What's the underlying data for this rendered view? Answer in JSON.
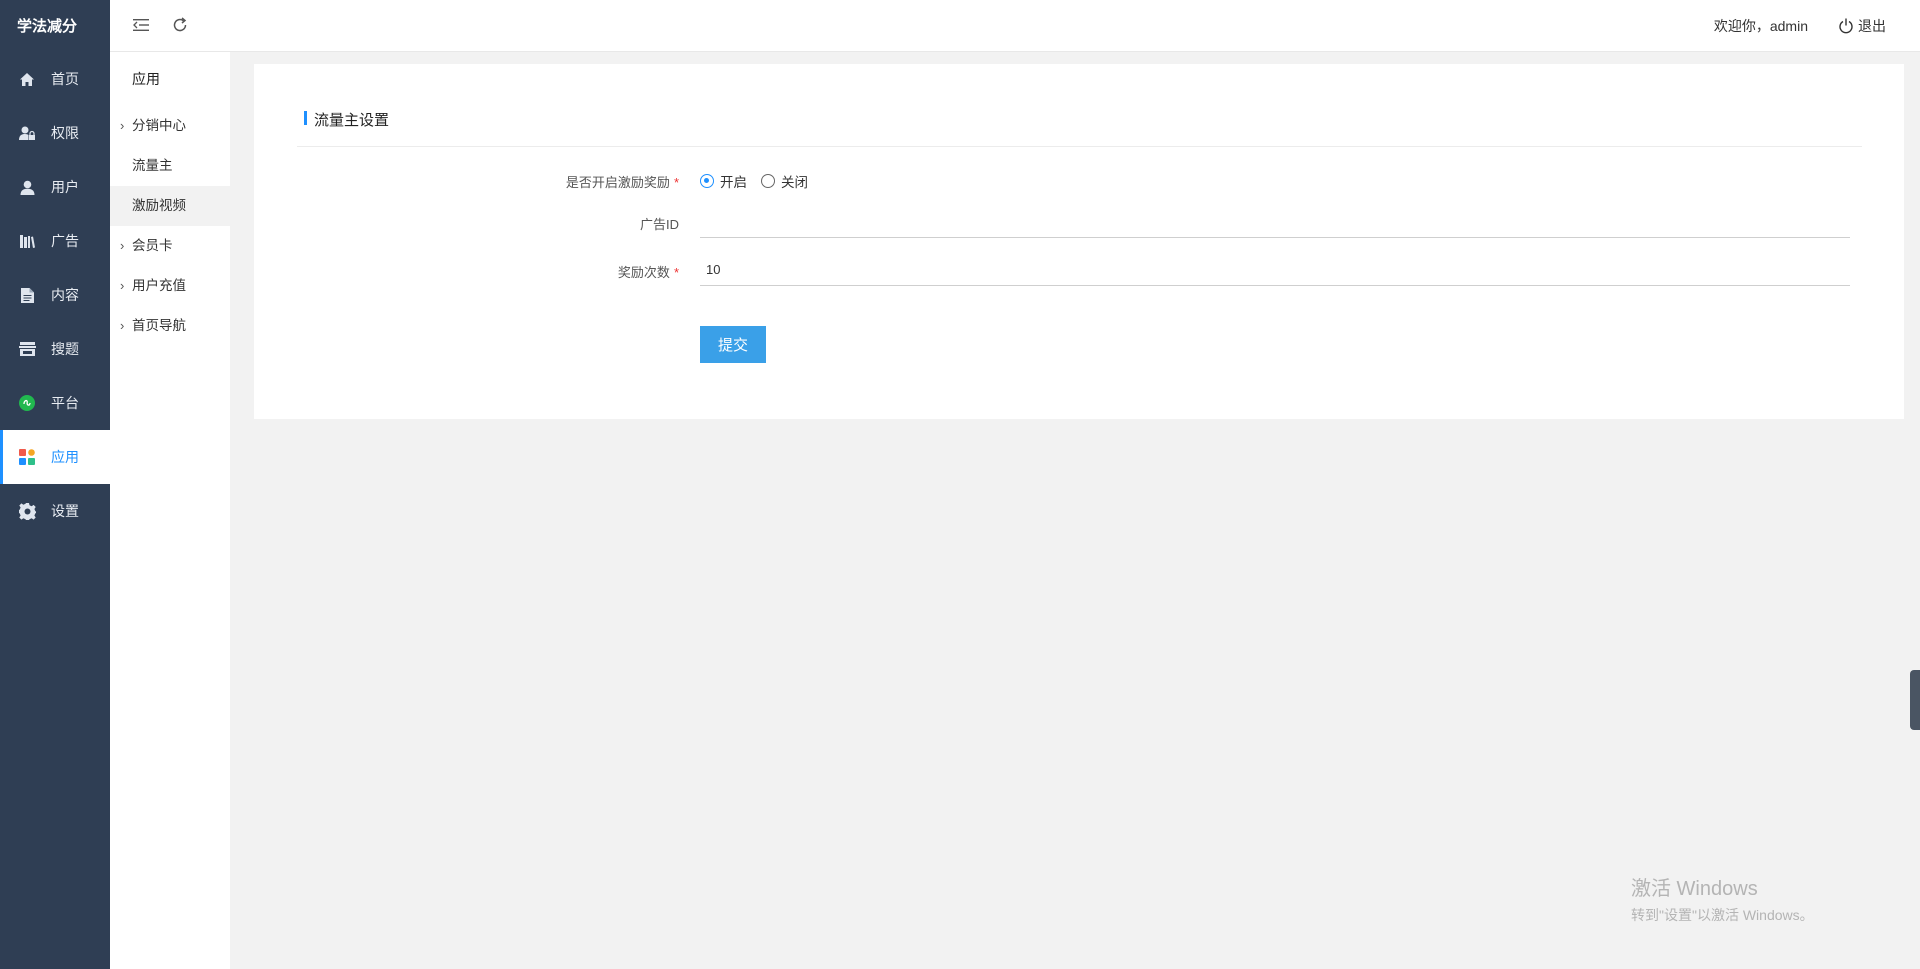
{
  "brand": "学法减分",
  "nav": [
    {
      "label": "首页",
      "icon": "home-icon"
    },
    {
      "label": "权限",
      "icon": "user-lock-icon"
    },
    {
      "label": "用户",
      "icon": "user-icon"
    },
    {
      "label": "广告",
      "icon": "books-icon"
    },
    {
      "label": "内容",
      "icon": "document-icon"
    },
    {
      "label": "搜题",
      "icon": "store-icon"
    },
    {
      "label": "平台",
      "icon": "wechat-icon"
    },
    {
      "label": "应用",
      "icon": "apps-icon",
      "active": true
    },
    {
      "label": "设置",
      "icon": "gear-icon"
    }
  ],
  "submenu": {
    "title": "应用",
    "items": [
      {
        "label": "分销中心",
        "expandable": true
      },
      {
        "label": "流量主",
        "expandable": false
      },
      {
        "label": "激励视频",
        "expandable": false,
        "active": true
      },
      {
        "label": "会员卡",
        "expandable": true
      },
      {
        "label": "用户充值",
        "expandable": true
      },
      {
        "label": "首页导航",
        "expandable": true
      }
    ]
  },
  "header": {
    "welcome": "欢迎你，admin",
    "logout": "退出"
  },
  "form": {
    "section_title": "流量主设置",
    "enable_label": "是否开启激励奖励",
    "enable_options": [
      "开启",
      "关闭"
    ],
    "enable_selected": "开启",
    "ad_id_label": "广告ID",
    "ad_id_value": "",
    "reward_count_label": "奖励次数",
    "reward_count_value": "10",
    "required_mark": "*",
    "submit_label": "提交"
  },
  "watermark": {
    "line1": "激活 Windows",
    "line2": "转到\"设置\"以激活 Windows。"
  },
  "colors": {
    "sidebar_bg": "#2f3e54",
    "accent": "#1e90ff",
    "button_bg": "#3aa0e8"
  }
}
